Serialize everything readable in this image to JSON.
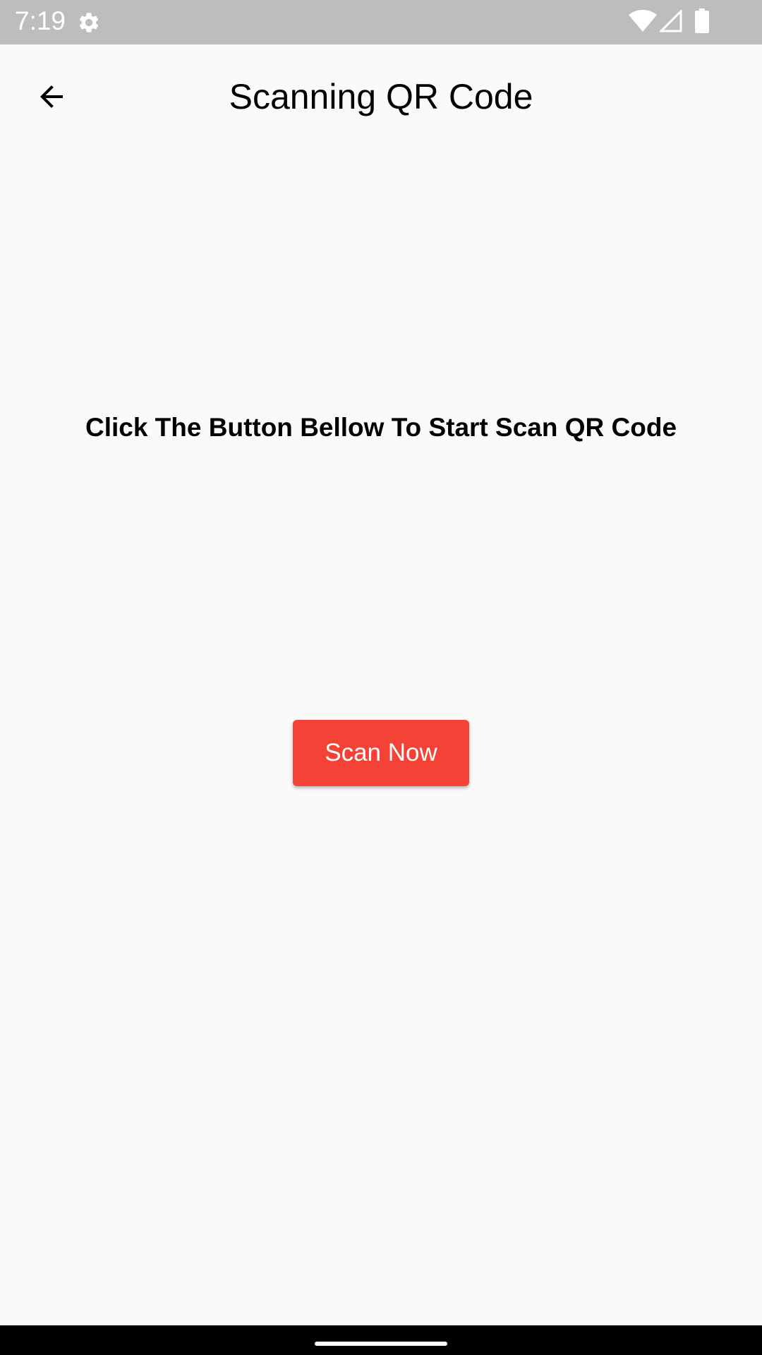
{
  "status_bar": {
    "time": "7:19",
    "icons": [
      "gear-icon",
      "wifi-icon",
      "signal-icon",
      "battery-icon"
    ],
    "background": "#bdbdbd"
  },
  "app_bar": {
    "title": "Scanning QR Code",
    "back_icon": "arrow-back-icon"
  },
  "main": {
    "instruction": "Click The Button Bellow To Start Scan QR Code",
    "scan_button_label": "Scan Now",
    "accent_color": "#f44336"
  },
  "nav_bar": {
    "handle": "gesture-nav-handle"
  }
}
